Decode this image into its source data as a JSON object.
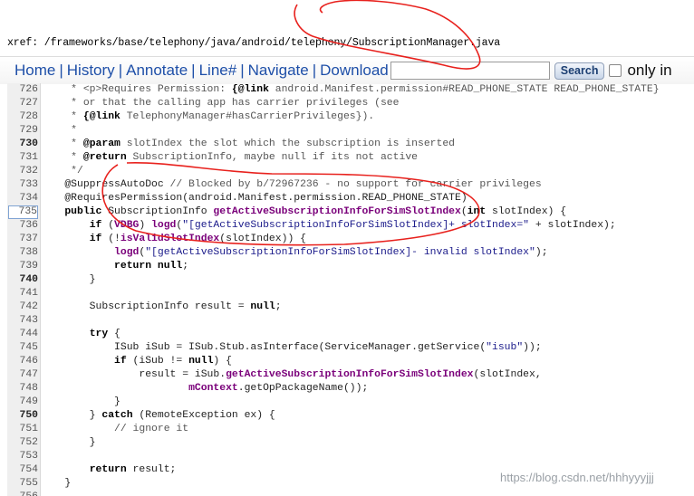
{
  "xref": {
    "label": "xref: /frameworks/base/telephony/java/android/telephony/SubscriptionManager.java"
  },
  "nav": {
    "links": [
      "Home",
      "History",
      "Annotate",
      "Line#",
      "Navigate",
      "Download"
    ],
    "search_value": "",
    "search_button": "Search",
    "only_label": "only in",
    "link_color": "#1e4fa8"
  },
  "code": {
    "selected_line": "735",
    "lines": [
      {
        "n": "726",
        "t": "     * <p>Requires Permission: {@link android.Manifest.permission#READ_PHONE_STATE READ_PHONE_STATE}"
      },
      {
        "n": "727",
        "t": "     * or that the calling app has carrier privileges (see"
      },
      {
        "n": "728",
        "t": "     * {@link TelephonyManager#hasCarrierPrivileges})."
      },
      {
        "n": "729",
        "t": "     *"
      },
      {
        "n": "730",
        "t": "     * @param slotIndex the slot which the subscription is inserted"
      },
      {
        "n": "731",
        "t": "     * @return SubscriptionInfo, maybe null if its not active"
      },
      {
        "n": "732",
        "t": "     */"
      },
      {
        "n": "733",
        "t": "    @SuppressAutoDoc // Blocked by b/72967236 - no support for carrier privileges"
      },
      {
        "n": "734",
        "t": "    @RequiresPermission(android.Manifest.permission.READ_PHONE_STATE)"
      },
      {
        "n": "735",
        "t": "    public SubscriptionInfo getActiveSubscriptionInfoForSimSlotIndex(int slotIndex) {"
      },
      {
        "n": "736",
        "t": "        if (VDBG) logd(\"[getActiveSubscriptionInfoForSimSlotIndex]+ slotIndex=\" + slotIndex);"
      },
      {
        "n": "737",
        "t": "        if (!isValidSlotIndex(slotIndex)) {"
      },
      {
        "n": "738",
        "t": "            logd(\"[getActiveSubscriptionInfoForSimSlotIndex]- invalid slotIndex\");"
      },
      {
        "n": "739",
        "t": "            return null;"
      },
      {
        "n": "740",
        "t": "        }"
      },
      {
        "n": "741",
        "t": ""
      },
      {
        "n": "742",
        "t": "        SubscriptionInfo result = null;"
      },
      {
        "n": "743",
        "t": ""
      },
      {
        "n": "744",
        "t": "        try {"
      },
      {
        "n": "745",
        "t": "            ISub iSub = ISub.Stub.asInterface(ServiceManager.getService(\"isub\"));"
      },
      {
        "n": "746",
        "t": "            if (iSub != null) {"
      },
      {
        "n": "747",
        "t": "                result = iSub.getActiveSubscriptionInfoForSimSlotIndex(slotIndex,"
      },
      {
        "n": "748",
        "t": "                        mContext.getOpPackageName());"
      },
      {
        "n": "749",
        "t": "            }"
      },
      {
        "n": "750",
        "t": "        } catch (RemoteException ex) {"
      },
      {
        "n": "751",
        "t": "            // ignore it"
      },
      {
        "n": "752",
        "t": "        }"
      },
      {
        "n": "753",
        "t": ""
      },
      {
        "n": "754",
        "t": "        return result;"
      },
      {
        "n": "755",
        "t": "    }"
      },
      {
        "n": "756",
        "t": ""
      }
    ]
  },
  "watermark": "https://blog.csdn.net/hhhyyyjjj",
  "annotation_color": "#e8211d"
}
